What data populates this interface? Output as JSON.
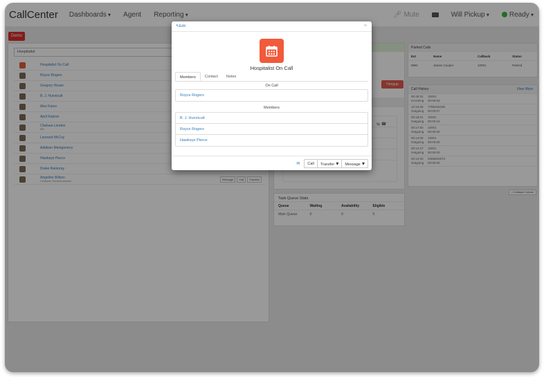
{
  "navbar": {
    "brand": "CallCenter",
    "dashboards": "Dashboards",
    "agent": "Agent",
    "reporting": "Reporting",
    "mute": "Mute",
    "user": "Will Pickup",
    "status": "Ready",
    "status_color": "#3fb53f"
  },
  "toolbar": {
    "demo_label": "Demo"
  },
  "left": {
    "search_value": "Hospitalist",
    "contacts": [
      {
        "name": "Hospitalist On Call",
        "sub": ""
      },
      {
        "name": "Royce Rogers",
        "sub": ""
      },
      {
        "name": "Gregory House",
        "sub": ""
      },
      {
        "name": "B. J. Hunnicutt",
        "sub": ""
      },
      {
        "name": "Alex Karev",
        "sub": ""
      },
      {
        "name": "April Kepner",
        "sub": ""
      },
      {
        "name": "Chelsea London",
        "sub": "MD"
      },
      {
        "name": "Leonard McCoy",
        "sub": ""
      },
      {
        "name": "Addison Montgomery",
        "sub": ""
      },
      {
        "name": "Hawkeye Pierce",
        "sub": ""
      },
      {
        "name": "Drake Ramoray",
        "sub": ""
      },
      {
        "name": "Angeline Wilson",
        "sub": "Customer Success Advisor"
      }
    ],
    "row_actions": {
      "message": "Message",
      "call": "Call",
      "transfer": "Transfer"
    }
  },
  "middle": {
    "hangup": "Hangup"
  },
  "task_queue": {
    "title": "Task Queue Stats",
    "headers": [
      "Queue",
      "Waiting",
      "Availability",
      "Eligible"
    ],
    "rows": [
      [
        "Main Queue",
        "0",
        "0",
        "0"
      ]
    ]
  },
  "parked": {
    "title": "Parked Calls",
    "headers": [
      "Ext",
      "Name",
      "Callback",
      "Status"
    ],
    "rows": [
      [
        "8981",
        "James Cooper",
        "10001",
        "Parked"
      ]
    ]
  },
  "history": {
    "title": "Call History",
    "view_more": "View More",
    "rows": [
      {
        "time": "00:40:31",
        "number": "10001",
        "dir": "Incoming",
        "dur": "00:00:53"
      },
      {
        "time": "10:16:08",
        "number": "7785334336",
        "dir": "Outgoing",
        "dur": "00:00:07"
      },
      {
        "time": "00:19:01",
        "number": "10001",
        "dir": "Outgoing",
        "dur": "00:00:16"
      },
      {
        "time": "00:17:50",
        "number": "10001",
        "dir": "Outgoing",
        "dur": "00:00:00"
      },
      {
        "time": "00:14:09",
        "number": "10001",
        "dir": "Outgoing",
        "dur": "00:00:00"
      },
      {
        "time": "00:13:47",
        "number": "10001",
        "dir": "Outgoing",
        "dur": "00:00:00"
      },
      {
        "time": "00:12:20",
        "number": "2065604973",
        "dir": "Outgoing",
        "dur": "00:00:00"
      }
    ]
  },
  "collapse_label": "« Collapse Column",
  "modal": {
    "edit": "Edit",
    "close": "×",
    "title": "Hospitalist On Call",
    "tabs": [
      "Members",
      "Contact",
      "Notes"
    ],
    "on_call_label": "On Call",
    "on_call": [
      "Royce Rogers"
    ],
    "members_label": "Members",
    "members": [
      "B. J. Hunnicutt",
      "Royce Rogers",
      "Hawkeye Pierce"
    ],
    "footer": {
      "call": "Call",
      "transfer": "Transfer",
      "message": "Message"
    },
    "icon_color": "#f15a3b"
  }
}
